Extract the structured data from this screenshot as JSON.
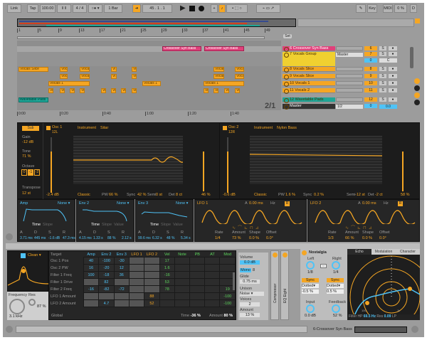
{
  "toolbar": {
    "link": "Link",
    "tap": "Tap",
    "tempo": "100.00",
    "signature": "4 / 4",
    "quantize": "1 Bar",
    "position": "45 . 1 . 1",
    "key": "Key",
    "midi": "MIDI",
    "cpu": "0 %",
    "overload": "D"
  },
  "arrangement": {
    "bar_numbers": [
      "1",
      "5",
      "9",
      "13",
      "17",
      "21",
      "25",
      "29",
      "33",
      "37",
      "41",
      "45",
      "49"
    ],
    "time_labels": [
      "0:00",
      "0:20",
      "0:40",
      "1:00",
      "1:20",
      "1:40"
    ],
    "zoom_readout": "2/1",
    "set_label": "Set",
    "clips": {
      "crossover": [
        "Crossover Syn Bass",
        "Crossover Syn Bass"
      ],
      "vocals_slice": "Vocals Slice",
      "vocal": "Vocal",
      "vi": "Vi",
      "vocals1": "Vocals 1",
      "wavetable": "Wavetable Pads"
    },
    "tracks": [
      {
        "name": "6 Crossover Syn Bass",
        "num": "6",
        "color": "#e0407a"
      },
      {
        "name": "7 Vocals Group",
        "num": "7",
        "color": "#f0d030",
        "route": "Master",
        "sub": "0",
        "c": "C"
      },
      {
        "name": "8 Vocals Slice",
        "num": "8",
        "color": "#f5a623"
      },
      {
        "name": "9 Vocals Slice",
        "num": "9",
        "color": "#f5a623"
      },
      {
        "name": "10 Vocals 1",
        "num": "10",
        "color": "#f5a623"
      },
      {
        "name": "11 Vocals 2",
        "num": "11",
        "color": "#f5a623"
      },
      {
        "name": "12 Wavetable Pads",
        "num": "12",
        "color": "#1fa596"
      },
      {
        "name": "Master",
        "num": "0",
        "route": "1/2",
        "vol": "0.0",
        "color": "#333"
      }
    ],
    "solo": "S"
  },
  "device": {
    "sub_button": "Sub",
    "gain_label": "Gain",
    "gain": "-12 dB",
    "tone_label": "Tone",
    "tone": "71 %",
    "octave_label": "Octave",
    "octaves": [
      "0",
      "-1",
      "-2"
    ],
    "transpose_label": "Transpose",
    "transpose": "12 st",
    "osc1": {
      "name": "Osc 1",
      "pos": "12L",
      "category": "Instrument",
      "wavetable": "Sitar",
      "level": "-2.4 dB",
      "mode": "Classic",
      "pw_label": "PW",
      "pw": "66 %",
      "sync_label": "Sync",
      "sync": "42 %",
      "semi_label": "Semi",
      "semi": "0 st",
      "det_label": "Det",
      "det": "8 ct",
      "pan": "46 %"
    },
    "osc2": {
      "name": "Osc 2",
      "pos": "12R",
      "category": "Instrument",
      "wavetable": "Nylon Bass",
      "level": "-0.6 dB",
      "mode": "Classic",
      "pw_label": "PW",
      "pw": "1.6 %",
      "sync_label": "Sync",
      "sync": "0.2 %",
      "semi_label": "Semi",
      "semi": "-12 st",
      "det_label": "Det",
      "det": "-2 ct",
      "pan": "58 %"
    },
    "envs": [
      {
        "name": "Amp",
        "dest": "None",
        "tabs": [
          "Time",
          "Slope"
        ],
        "labels": [
          "A",
          "D",
          "S",
          "R"
        ],
        "values": [
          "3.71 ms",
          "445 ms",
          "-1.6 dB",
          "47.3 ms"
        ]
      },
      {
        "name": "Env 2",
        "dest": "None",
        "tabs": [
          "Time",
          "Slope",
          "Value"
        ],
        "labels": [
          "A",
          "D",
          "S",
          "R"
        ],
        "values": [
          "4.15 ms",
          "1.33 s",
          "88 %",
          "2.12 s"
        ]
      },
      {
        "name": "Env 3",
        "dest": "None",
        "tabs": [
          "Time",
          "Slope",
          "Value"
        ],
        "labels": [
          "A",
          "D",
          "S",
          "R"
        ],
        "values": [
          "99.6 ms",
          "6.32 s",
          "48 %",
          "5.34 s"
        ]
      }
    ],
    "lfos": [
      {
        "name": "LFO 1",
        "attack_label": "A",
        "attack": "0.00 ms",
        "hz": "Hz",
        "labels": [
          "Rate",
          "Amount",
          "Shape",
          "Offset"
        ],
        "values": [
          "1/4",
          "73 %",
          "0.0 %",
          "0.0°"
        ],
        "r": "R"
      },
      {
        "name": "LFO 2",
        "attack_label": "A",
        "attack": "0.00 ms",
        "hz": "Hz",
        "labels": [
          "Rate",
          "Amount",
          "Shape",
          "Offset"
        ],
        "values": [
          "1/3",
          "66 %",
          "0.0 %",
          "0.0°"
        ],
        "r": "R"
      }
    ]
  },
  "filter": {
    "type": "Clean",
    "freq_label": "Frequency",
    "freq": "3.1 kHz",
    "res_label": "Res",
    "res": "87 %"
  },
  "matrix": {
    "headers": [
      "Target",
      "Amp",
      "Env 2",
      "Env 3",
      "LFO 1",
      "LFO 2",
      "Vel",
      "Note",
      "PB",
      "AT",
      "Mod"
    ],
    "rows": [
      [
        "Osc 1 Pos",
        "40",
        "-100",
        "-30",
        "",
        "",
        "17",
        "",
        "",
        "",
        ""
      ],
      [
        "Osc 2 PW",
        "16",
        "-20",
        "12",
        "",
        "",
        "1.6",
        "",
        "",
        "",
        ""
      ],
      [
        "Filter 1 Freq",
        "100",
        "-18",
        "36",
        "",
        "",
        "-16",
        "",
        "",
        "",
        ""
      ],
      [
        "Filter 1 Drive",
        "",
        "82",
        "",
        "",
        "",
        "53",
        "",
        "",
        "",
        ""
      ],
      [
        "Filter 2 Freq",
        "-16",
        "-82",
        "-72",
        "",
        "",
        "78",
        "",
        "",
        "",
        "19"
      ],
      [
        "LFO 1 Amount",
        "",
        "",
        "",
        "",
        "88",
        "",
        "",
        "",
        "",
        "-100"
      ],
      [
        "LFO 2 Amount",
        "",
        "4.7",
        "",
        "",
        "52",
        "",
        "",
        "",
        "",
        "-100"
      ]
    ],
    "global": "Global",
    "time_label": "Time",
    "time": "-36 %",
    "amount_label": "Amount",
    "amount": "80 %"
  },
  "synth": {
    "volume_label": "Volume",
    "volume": "0.0 dB",
    "mono": "Mono",
    "mono_val": "8",
    "glide_label": "Glide",
    "glide": "0.75 ms",
    "unison_label": "Unison",
    "unison": "Noise",
    "voices_label": "Voices",
    "voices": "2",
    "amount_label": "Amount",
    "amount": "13 %"
  },
  "strips": [
    "Compressor",
    "EQ Eight"
  ],
  "echo": {
    "preset": "Nostalgia",
    "tabs": [
      "Echo",
      "Modulation",
      "Character"
    ],
    "left_label": "Left",
    "left": "1/8",
    "right_label": "Right",
    "right": "1/4",
    "sync": "Sync",
    "mode": "Dotted",
    "left_offset": "-0.5 %",
    "right_offset": "0.5 %",
    "input_label": "Input",
    "input": "0.0 dB",
    "feedback_label": "Feedback",
    "feedback": "52 %",
    "filter_label": "Filter HP",
    "filter_hp": "69.5 Hz",
    "res_label": "Res",
    "res": "0.09",
    "lp_label": "LP",
    "scale": [
      "100",
      "1k"
    ]
  },
  "status": {
    "track": "6-Crossover Syn Bass"
  },
  "colors": {
    "accent": "#f5a623",
    "blue": "#4fc3f7",
    "green": "#5cd65c",
    "pink": "#e0407a",
    "teal": "#1fa596"
  }
}
